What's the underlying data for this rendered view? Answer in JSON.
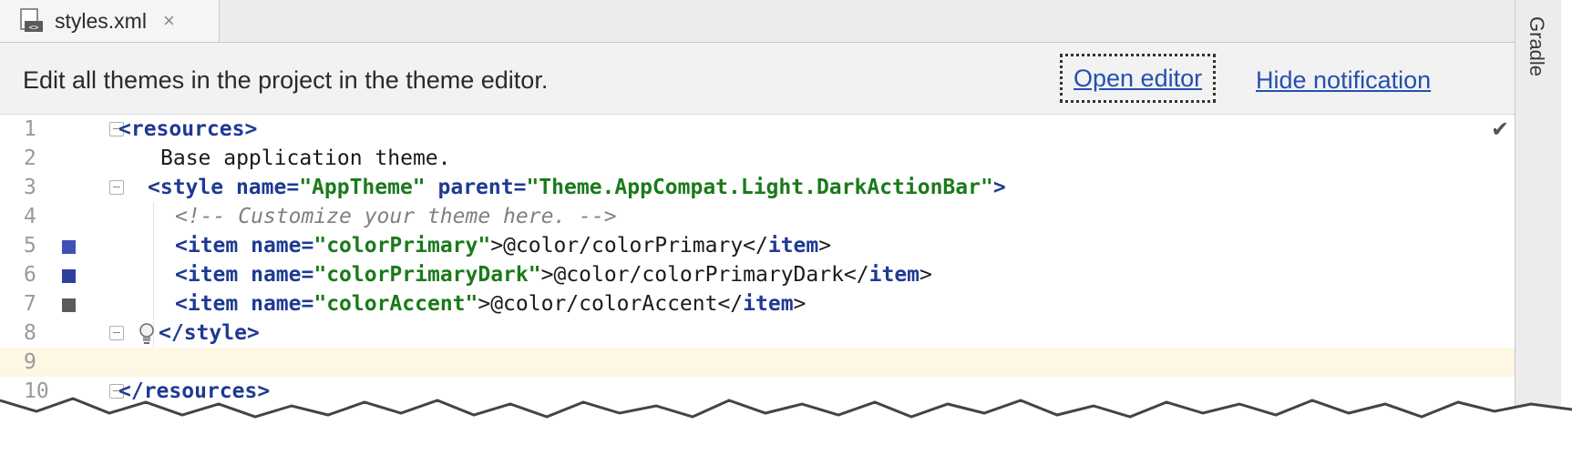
{
  "tab": {
    "label": "styles.xml",
    "close": "×"
  },
  "notification": {
    "message": "Edit all themes in the project in the theme editor.",
    "open_editor": "Open editor",
    "hide_notification": "Hide notification"
  },
  "side_strip": {
    "label": "Gradle"
  },
  "editor": {
    "line_numbers": [
      "1",
      "2",
      "3",
      "4",
      "5",
      "6",
      "7",
      "8",
      "9",
      "10"
    ],
    "swatches": {
      "colorPrimary": "#3f51b5",
      "colorPrimaryDark": "#303f9f",
      "colorAccent": "#5b5b5b"
    },
    "lines": {
      "l1_tag": "<resources>",
      "l2_text": "Base application theme.",
      "l3_open": "<style ",
      "l3_attr1": "name=",
      "l3_val1": "\"AppTheme\"",
      "l3_attr2": " parent=",
      "l3_val2": "\"Theme.AppCompat.Light.DarkActionBar\"",
      "l3_close": ">",
      "l4_comment": "<!-- Customize your theme here. -->",
      "l5_open": "<item ",
      "l5_attr": "name=",
      "l5_val": "\"colorPrimary\"",
      "l5_body": ">@color/colorPrimary</",
      "l5_tag": "item",
      "l5_end": ">",
      "l6_open": "<item ",
      "l6_attr": "name=",
      "l6_val": "\"colorPrimaryDark\"",
      "l6_body": ">@color/colorPrimaryDark</",
      "l6_tag": "item",
      "l6_end": ">",
      "l7_open": "<item ",
      "l7_attr": "name=",
      "l7_val": "\"colorAccent\"",
      "l7_body": ">@color/colorAccent</",
      "l7_tag": "item",
      "l7_end": ">",
      "l8_tag": "</style>",
      "l10_tag": "</resources>"
    }
  }
}
